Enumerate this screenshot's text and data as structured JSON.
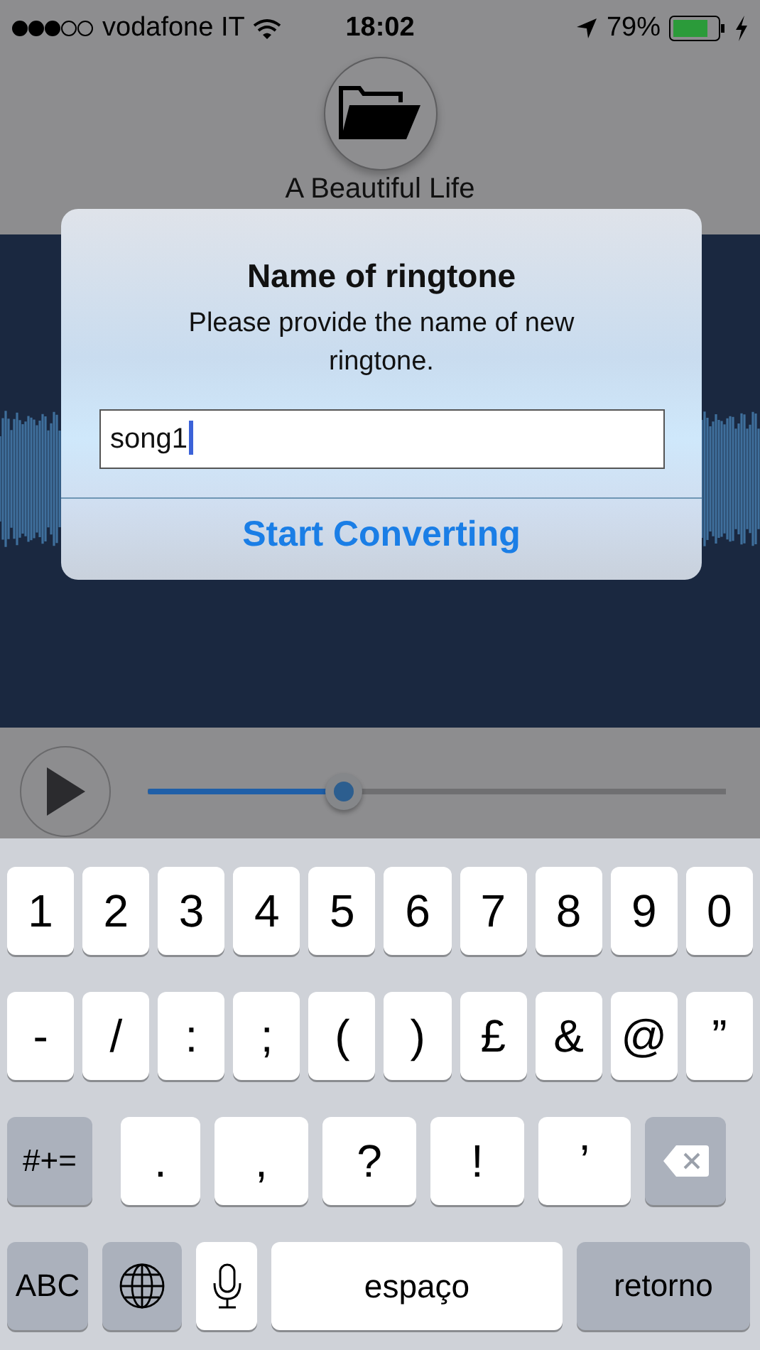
{
  "status_bar": {
    "carrier": "vodafone IT",
    "time": "18:02",
    "battery": "79%"
  },
  "player": {
    "track_title": "A Beautiful Life",
    "progress": {
      "level": 0.34
    }
  },
  "dialog": {
    "title": "Name of ringtone",
    "message": "Please provide the name of new ringtone.",
    "field": {
      "value": "song1"
    },
    "button": "Start Converting"
  },
  "keyboard": {
    "rows": [
      {
        "keys": [
          {
            "kind": "char",
            "label": "1"
          },
          {
            "kind": "char",
            "label": "2"
          },
          {
            "kind": "char",
            "label": "3"
          },
          {
            "kind": "char",
            "label": "4"
          },
          {
            "kind": "char",
            "label": "5"
          },
          {
            "kind": "char",
            "label": "6"
          },
          {
            "kind": "char",
            "label": "7"
          },
          {
            "kind": "char",
            "label": "8"
          },
          {
            "kind": "char",
            "label": "9"
          },
          {
            "kind": "char",
            "label": "0"
          }
        ]
      },
      {
        "keys": [
          {
            "kind": "char",
            "label": "-"
          },
          {
            "kind": "char",
            "label": "/"
          },
          {
            "kind": "char",
            "label": ":"
          },
          {
            "kind": "char",
            "label": ";"
          },
          {
            "kind": "char",
            "label": "("
          },
          {
            "kind": "char",
            "label": ")"
          },
          {
            "kind": "char",
            "label": "£"
          },
          {
            "kind": "char",
            "label": "&"
          },
          {
            "kind": "char",
            "label": "@"
          },
          {
            "kind": "char",
            "label": "”"
          }
        ]
      },
      {
        "keys": [
          {
            "kind": "mod",
            "label": "#+="
          },
          {
            "kind": "char",
            "label": "."
          },
          {
            "kind": "char",
            "label": ","
          },
          {
            "kind": "char",
            "label": "?"
          },
          {
            "kind": "char",
            "label": "!"
          },
          {
            "kind": "char",
            "label": "’"
          },
          {
            "kind": "delete"
          }
        ]
      },
      {
        "keys": [
          {
            "kind": "mod",
            "label": "ABC"
          },
          {
            "kind": "globe"
          },
          {
            "kind": "mic"
          },
          {
            "kind": "space",
            "label": "espaço"
          },
          {
            "kind": "mod",
            "label": "retorno"
          }
        ]
      }
    ]
  }
}
